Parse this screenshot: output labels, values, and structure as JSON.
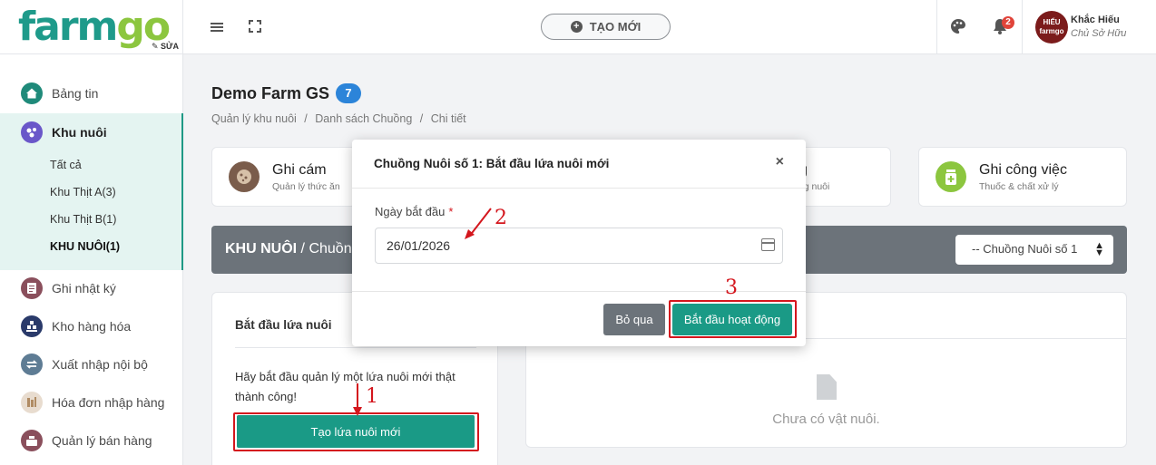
{
  "brand": {
    "logo_text_a": "farm",
    "logo_text_b": "go",
    "edit_label": "✎ SỬA"
  },
  "sidebar": {
    "items": [
      {
        "label": "Bảng tin",
        "icon": "home-icon"
      },
      {
        "label": "Khu nuôi",
        "icon": "farm-icon"
      },
      {
        "label": "Ghi nhật ký",
        "icon": "notebook-icon"
      },
      {
        "label": "Kho hàng hóa",
        "icon": "warehouse-icon"
      },
      {
        "label": "Xuất nhập nội bộ",
        "icon": "transfer-icon"
      },
      {
        "label": "Hóa đơn nhập hàng",
        "icon": "invoice-icon"
      },
      {
        "label": "Quản lý bán hàng",
        "icon": "register-icon"
      }
    ],
    "sub_items": [
      "Tất cả",
      "Khu Thịt A(3)",
      "Khu Thịt B(1)",
      "KHU NUÔI(1)"
    ]
  },
  "topbar": {
    "create_label": "TẠO MỚI",
    "notification_count": "2",
    "avatar_text_a": "HIẾU",
    "avatar_text_b": "farmgo",
    "user_name": "Khắc Hiếu",
    "user_role": "Chủ Sở Hữu"
  },
  "page": {
    "title": "Demo Farm GS",
    "badge": "7",
    "breadcrumb": [
      "Quản lý khu nuôi",
      "/",
      "Danh sách Chuồng",
      "/",
      "Chi tiết"
    ]
  },
  "quick_cards": [
    {
      "title": "Ghi cám",
      "subtitle": "Quản lý thức ăn",
      "color": "#7a5c4b"
    },
    {
      "title": "g",
      "subtitle": "ờng nuôi",
      "color": "#2c84d9"
    },
    {
      "title": "Ghi công việc",
      "subtitle": "Thuốc & chất xử lý",
      "color": "#8cc63f"
    }
  ],
  "section": {
    "title_bold": "KHU NUÔI",
    "title_rest": " / Chuồng",
    "select_value": "-- Chuồng Nuôi số 1"
  },
  "left_panel": {
    "title": "Bắt đầu lứa nuôi",
    "text": "Hãy bắt đầu quản lý một lứa nuôi mới thật thành công!",
    "button": "Tạo lứa nuôi mới"
  },
  "right_panel": {
    "empty_text": "Chưa có vật nuôi."
  },
  "modal": {
    "title": "Chuồng Nuôi số 1: Bắt đầu lứa nuôi mới",
    "close": "×",
    "field_label": "Ngày bắt đầu",
    "required_mark": "*",
    "date_value": "26/01/2026",
    "skip_label": "Bỏ qua",
    "start_label": "Bắt đầu hoạt động"
  },
  "annotations": {
    "n1": "1",
    "n2": "2",
    "n3": "3"
  },
  "colors": {
    "primary": "#1a9a86",
    "annotation": "#d4161d",
    "badge": "#2c84d9"
  }
}
